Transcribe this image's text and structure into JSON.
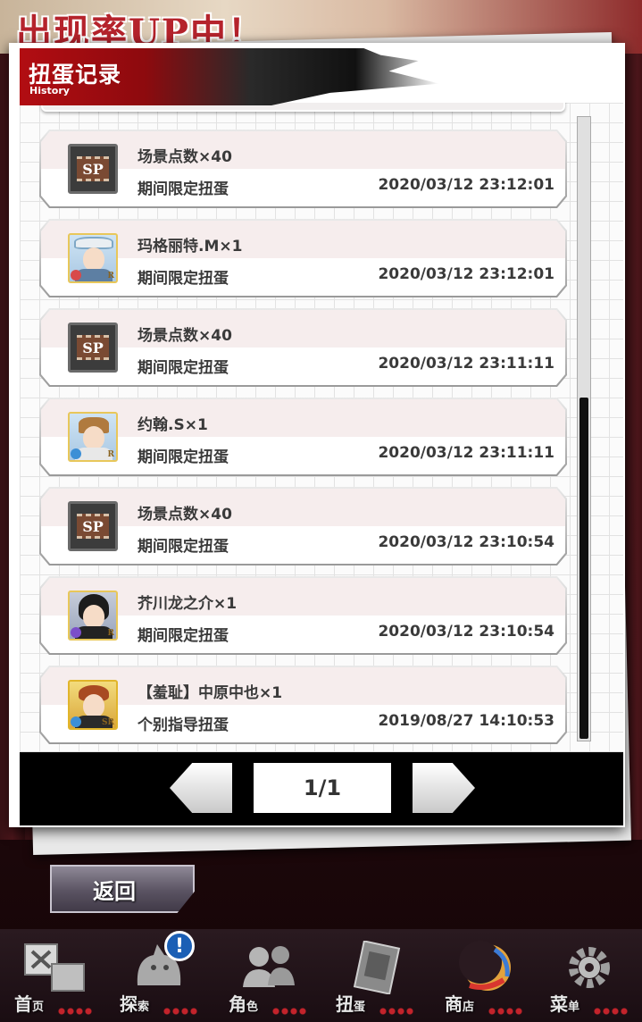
{
  "background": {
    "banner_text": "出现率UP中！"
  },
  "header": {
    "title": "扭蛋记录",
    "subtitle": "History"
  },
  "records": [
    {
      "item": "场景点数×40",
      "source": "期间限定扭蛋",
      "time": "2020/03/12 23:12:01",
      "thumb": "sp"
    },
    {
      "item": "玛格丽特.M×1",
      "source": "期间限定扭蛋",
      "time": "2020/03/12 23:12:01",
      "thumb": "char",
      "rank": "R"
    },
    {
      "item": "场景点数×40",
      "source": "期间限定扭蛋",
      "time": "2020/03/12 23:11:11",
      "thumb": "sp"
    },
    {
      "item": "约翰.S×1",
      "source": "期间限定扭蛋",
      "time": "2020/03/12 23:11:11",
      "thumb": "char",
      "rank": "R"
    },
    {
      "item": "场景点数×40",
      "source": "期间限定扭蛋",
      "time": "2020/03/12 23:10:54",
      "thumb": "sp"
    },
    {
      "item": "芥川龙之介×1",
      "source": "期间限定扭蛋",
      "time": "2020/03/12 23:10:54",
      "thumb": "char",
      "rank": "R"
    },
    {
      "item": "【羞耻】中原中也×1",
      "source": "个别指导扭蛋",
      "time": "2019/08/27 14:10:53",
      "thumb": "char",
      "rank": "SR"
    }
  ],
  "sp_label": "SP",
  "pager": {
    "label": "1/1"
  },
  "back_button": "返回",
  "nav": {
    "home": {
      "label": "首",
      "sub": "页"
    },
    "explore": {
      "label": "探",
      "sub": "索",
      "badge": "!"
    },
    "characters": {
      "label": "角",
      "sub": "色"
    },
    "gacha": {
      "label": "扭",
      "sub": "蛋"
    },
    "shop": {
      "label": "商",
      "sub": "店"
    },
    "menu": {
      "label": "菜",
      "sub": "单"
    }
  },
  "colors": {
    "header_red": "#b20d12",
    "scrollbar": "#111111",
    "badge_blue": "#1b5fb5"
  }
}
